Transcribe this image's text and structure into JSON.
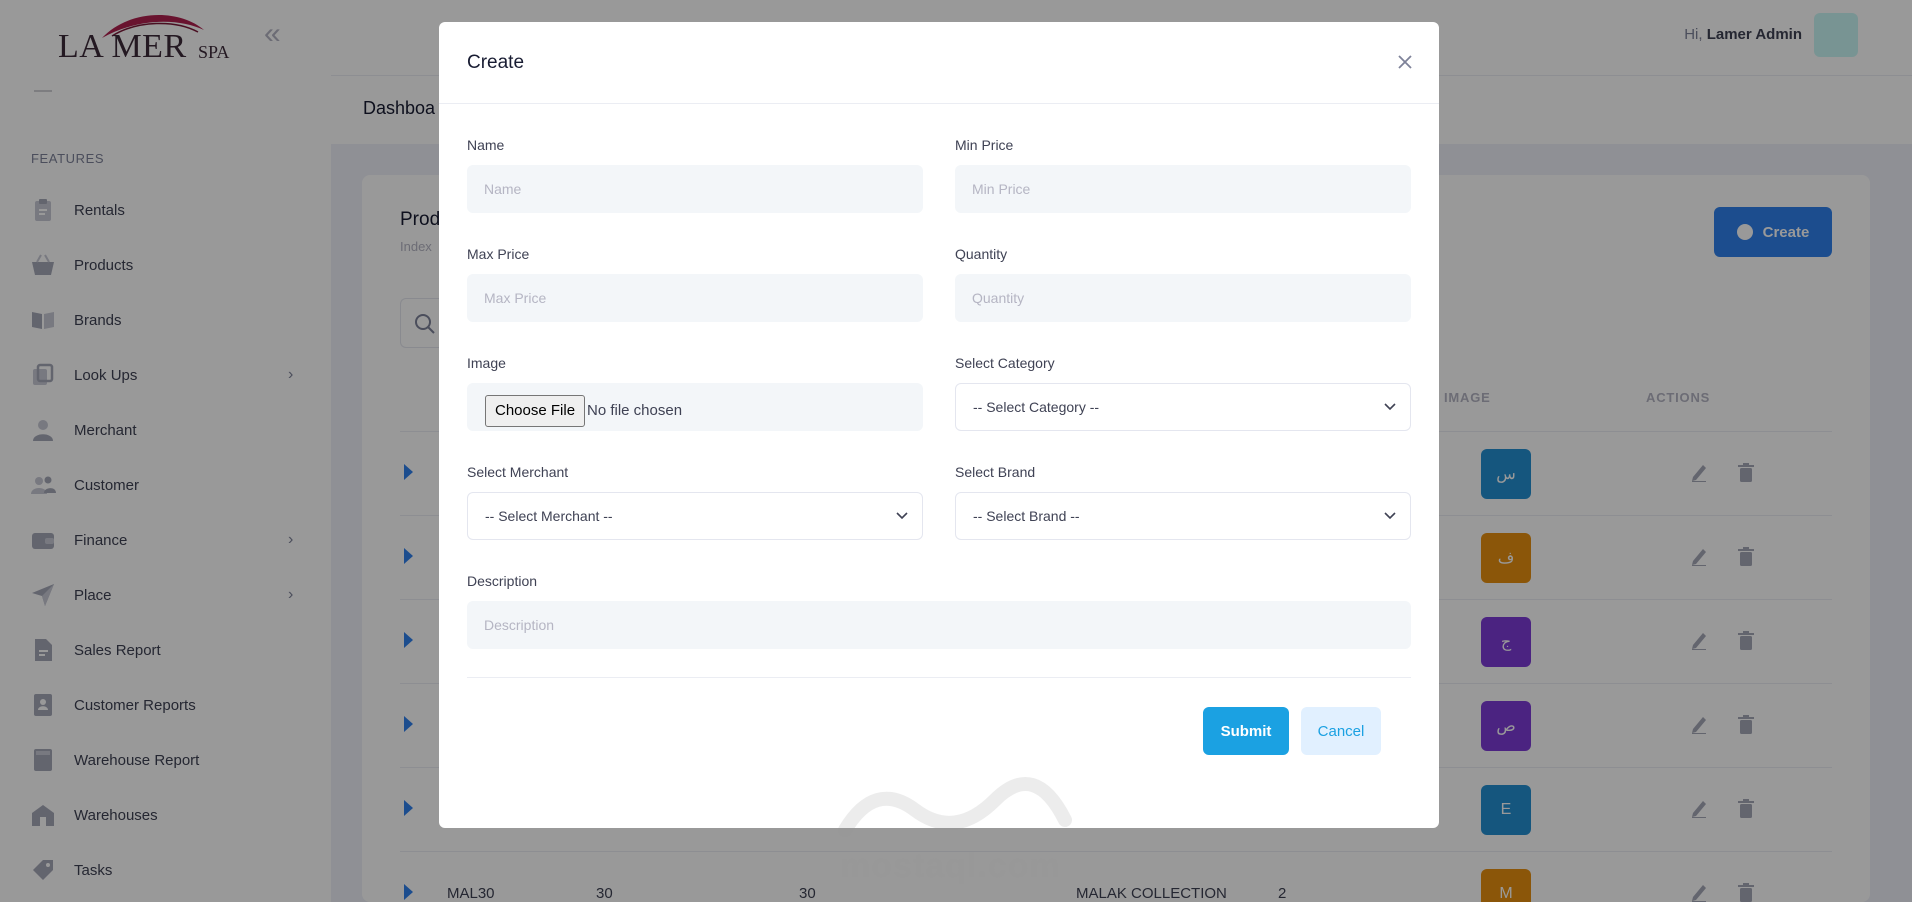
{
  "brand": {
    "logo_text": "LA MER",
    "logo_sub": "SPA"
  },
  "sidebar": {
    "section_label": "FEATURES",
    "items": [
      {
        "label": "Rentals",
        "icon": "clipboard-icon",
        "chevron": false
      },
      {
        "label": "Products",
        "icon": "basket-icon",
        "chevron": false
      },
      {
        "label": "Brands",
        "icon": "book-icon",
        "chevron": false
      },
      {
        "label": "Look Ups",
        "icon": "layers-icon",
        "chevron": true
      },
      {
        "label": "Merchant",
        "icon": "user-icon",
        "chevron": false
      },
      {
        "label": "Customer",
        "icon": "users-icon",
        "chevron": false
      },
      {
        "label": "Finance",
        "icon": "wallet-icon",
        "chevron": true
      },
      {
        "label": "Place",
        "icon": "navigation-icon",
        "chevron": true
      },
      {
        "label": "Sales Report",
        "icon": "file-icon",
        "chevron": false
      },
      {
        "label": "Customer Reports",
        "icon": "contact-card-icon",
        "chevron": false
      },
      {
        "label": "Warehouse Report",
        "icon": "book-closed-icon",
        "chevron": false
      },
      {
        "label": "Warehouses",
        "icon": "home-icon",
        "chevron": false
      },
      {
        "label": "Tasks",
        "icon": "tag-icon",
        "chevron": false
      }
    ]
  },
  "topbar": {
    "greeting": "Hi,",
    "user_name": "Lamer Admin"
  },
  "subheader": {
    "breadcrumb": "Dashboa"
  },
  "card": {
    "title": "Prod",
    "subtitle": "Index",
    "create_label": "Create",
    "columns": {
      "image": "IMAGE",
      "actions": "ACTIONS"
    },
    "rows": [
      {
        "code": "",
        "c2": "",
        "c3": "",
        "brand": "",
        "qty": "",
        "thumb": "س",
        "thumb_color": "#2390d3"
      },
      {
        "code": "",
        "c2": "",
        "c3": "",
        "brand": "",
        "qty": "",
        "thumb": "ف",
        "thumb_color": "#e89010"
      },
      {
        "code": "",
        "c2": "",
        "c3": "",
        "brand": "",
        "qty": "",
        "thumb": "ج",
        "thumb_color": "#7e3bd8"
      },
      {
        "code": "",
        "c2": "",
        "c3": "",
        "brand": "",
        "qty": "",
        "thumb": "ص",
        "thumb_color": "#7e3bd8"
      },
      {
        "code": "",
        "c2": "",
        "c3": "",
        "brand": "",
        "qty": "",
        "thumb": "E",
        "thumb_color": "#2390d3"
      },
      {
        "code": "MAL30",
        "c2": "30",
        "c3": "30",
        "brand": "MALAK COLLECTION",
        "qty": "2",
        "thumb": "M",
        "thumb_color": "#e89010"
      }
    ]
  },
  "modal": {
    "title": "Create",
    "name": {
      "label": "Name",
      "placeholder": "Name"
    },
    "min_price": {
      "label": "Min Price",
      "placeholder": "Min Price"
    },
    "max_price": {
      "label": "Max Price",
      "placeholder": "Max Price"
    },
    "quantity": {
      "label": "Quantity",
      "placeholder": "Quantity"
    },
    "image": {
      "label": "Image",
      "button": "Choose File",
      "status": "No file chosen"
    },
    "category": {
      "label": "Select Category",
      "value": "-- Select Category --"
    },
    "merchant": {
      "label": "Select Merchant",
      "value": "-- Select Merchant --"
    },
    "brand": {
      "label": "Select Brand",
      "value": "-- Select Brand --"
    },
    "description": {
      "label": "Description",
      "placeholder": "Description"
    },
    "submit_label": "Submit",
    "cancel_label": "Cancel"
  },
  "watermark": {
    "text": "mostaql.com"
  },
  "colors": {
    "primary": "#2f80ed",
    "info": "#1ba1e2",
    "input_bg": "#f3f6f9"
  }
}
